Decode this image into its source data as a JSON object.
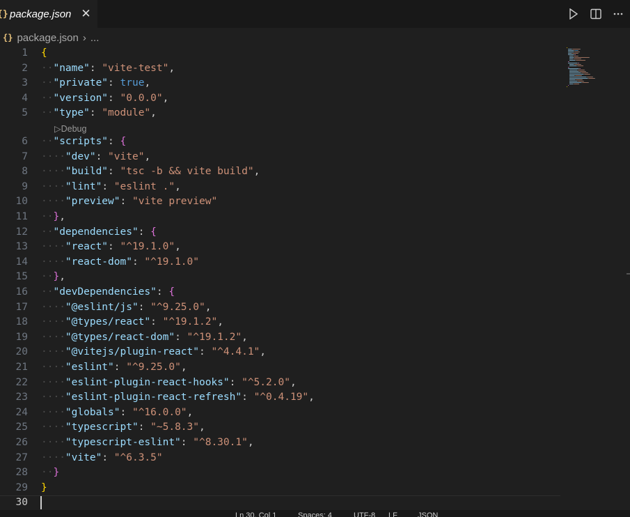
{
  "tab": {
    "label": "package.json",
    "close": "✕",
    "icon": "{}"
  },
  "breadcrumb": {
    "file": "package.json",
    "ellipsis": "...",
    "icon": "{}"
  },
  "codelens": {
    "label": "Debug"
  },
  "lines": [
    [
      [
        "br1",
        "{"
      ]
    ],
    [
      [
        "k",
        "\"name\""
      ],
      [
        "p",
        ": "
      ],
      [
        "s",
        "\"vite-test\""
      ],
      [
        "p",
        ","
      ]
    ],
    [
      [
        "k",
        "\"private\""
      ],
      [
        "p",
        ": "
      ],
      [
        "b",
        "true"
      ],
      [
        "p",
        ","
      ]
    ],
    [
      [
        "k",
        "\"version\""
      ],
      [
        "p",
        ": "
      ],
      [
        "s",
        "\"0.0.0\""
      ],
      [
        "p",
        ","
      ]
    ],
    [
      [
        "k",
        "\"type\""
      ],
      [
        "p",
        ": "
      ],
      [
        "s",
        "\"module\""
      ],
      [
        "p",
        ","
      ]
    ],
    [
      [
        "k",
        "\"scripts\""
      ],
      [
        "p",
        ": "
      ],
      [
        "br2",
        "{"
      ]
    ],
    [
      [
        "k",
        "\"dev\""
      ],
      [
        "p",
        ": "
      ],
      [
        "s",
        "\"vite\""
      ],
      [
        "p",
        ","
      ]
    ],
    [
      [
        "k",
        "\"build\""
      ],
      [
        "p",
        ": "
      ],
      [
        "s",
        "\"tsc -b && vite build\""
      ],
      [
        "p",
        ","
      ]
    ],
    [
      [
        "k",
        "\"lint\""
      ],
      [
        "p",
        ": "
      ],
      [
        "s",
        "\"eslint .\""
      ],
      [
        "p",
        ","
      ]
    ],
    [
      [
        "k",
        "\"preview\""
      ],
      [
        "p",
        ": "
      ],
      [
        "s",
        "\"vite preview\""
      ]
    ],
    [
      [
        "br2",
        "}"
      ],
      [
        "p",
        ","
      ]
    ],
    [
      [
        "k",
        "\"dependencies\""
      ],
      [
        "p",
        ": "
      ],
      [
        "br2",
        "{"
      ]
    ],
    [
      [
        "k",
        "\"react\""
      ],
      [
        "p",
        ": "
      ],
      [
        "s",
        "\"^19.1.0\""
      ],
      [
        "p",
        ","
      ]
    ],
    [
      [
        "k",
        "\"react-dom\""
      ],
      [
        "p",
        ": "
      ],
      [
        "s",
        "\"^19.1.0\""
      ]
    ],
    [
      [
        "br2",
        "}"
      ],
      [
        "p",
        ","
      ]
    ],
    [
      [
        "k",
        "\"devDependencies\""
      ],
      [
        "p",
        ": "
      ],
      [
        "br2",
        "{"
      ]
    ],
    [
      [
        "k",
        "\"@eslint/js\""
      ],
      [
        "p",
        ": "
      ],
      [
        "s",
        "\"^9.25.0\""
      ],
      [
        "p",
        ","
      ]
    ],
    [
      [
        "k",
        "\"@types/react\""
      ],
      [
        "p",
        ": "
      ],
      [
        "s",
        "\"^19.1.2\""
      ],
      [
        "p",
        ","
      ]
    ],
    [
      [
        "k",
        "\"@types/react-dom\""
      ],
      [
        "p",
        ": "
      ],
      [
        "s",
        "\"^19.1.2\""
      ],
      [
        "p",
        ","
      ]
    ],
    [
      [
        "k",
        "\"@vitejs/plugin-react\""
      ],
      [
        "p",
        ": "
      ],
      [
        "s",
        "\"^4.4.1\""
      ],
      [
        "p",
        ","
      ]
    ],
    [
      [
        "k",
        "\"eslint\""
      ],
      [
        "p",
        ": "
      ],
      [
        "s",
        "\"^9.25.0\""
      ],
      [
        "p",
        ","
      ]
    ],
    [
      [
        "k",
        "\"eslint-plugin-react-hooks\""
      ],
      [
        "p",
        ": "
      ],
      [
        "s",
        "\"^5.2.0\""
      ],
      [
        "p",
        ","
      ]
    ],
    [
      [
        "k",
        "\"eslint-plugin-react-refresh\""
      ],
      [
        "p",
        ": "
      ],
      [
        "s",
        "\"^0.4.19\""
      ],
      [
        "p",
        ","
      ]
    ],
    [
      [
        "k",
        "\"globals\""
      ],
      [
        "p",
        ": "
      ],
      [
        "s",
        "\"^16.0.0\""
      ],
      [
        "p",
        ","
      ]
    ],
    [
      [
        "k",
        "\"typescript\""
      ],
      [
        "p",
        ": "
      ],
      [
        "s",
        "\"~5.8.3\""
      ],
      [
        "p",
        ","
      ]
    ],
    [
      [
        "k",
        "\"typescript-eslint\""
      ],
      [
        "p",
        ": "
      ],
      [
        "s",
        "\"^8.30.1\""
      ],
      [
        "p",
        ","
      ]
    ],
    [
      [
        "k",
        "\"vite\""
      ],
      [
        "p",
        ": "
      ],
      [
        "s",
        "\"^6.3.5\""
      ]
    ],
    [
      [
        "br2",
        "}"
      ]
    ],
    [
      [
        "br1",
        "}"
      ]
    ],
    []
  ],
  "indents": [
    0,
    1,
    1,
    1,
    1,
    1,
    2,
    2,
    2,
    2,
    1,
    1,
    2,
    2,
    1,
    1,
    2,
    2,
    2,
    2,
    2,
    2,
    2,
    2,
    2,
    2,
    2,
    1,
    0,
    0
  ],
  "active_line": 30,
  "colors": {
    "key": "#9cdcfe",
    "string": "#ce9178",
    "bool": "#569cd6",
    "bracket1": "#ffd700",
    "bracket2": "#da70d6"
  },
  "status": {
    "position": "Ln 30, Col 1",
    "spaces": "Spaces: 4",
    "encoding": "UTF-8",
    "eol": "LF",
    "language": "JSON"
  }
}
